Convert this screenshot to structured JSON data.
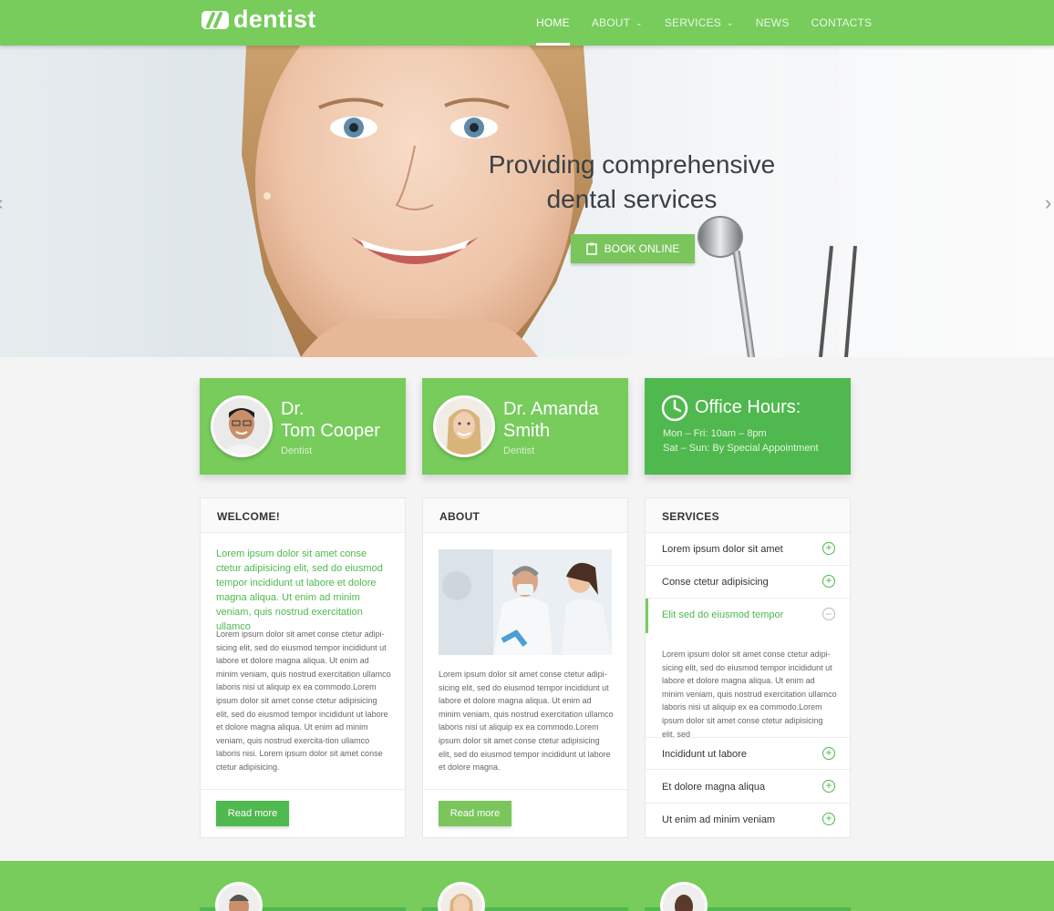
{
  "brand": {
    "name": "dentist",
    "accent": "#77cc5c",
    "accent_dark": "#4fb84e"
  },
  "nav": {
    "items": [
      {
        "label": "HOME",
        "active": true
      },
      {
        "label": "ABOUT",
        "has_dropdown": true
      },
      {
        "label": "SERVICES",
        "has_dropdown": true
      },
      {
        "label": "NEWS"
      },
      {
        "label": "CONTACTS"
      }
    ]
  },
  "hero": {
    "title_line1": "Providing comprehensive",
    "title_line2": "dental services",
    "button_label": "BOOK ONLINE",
    "button_icon": "clipboard-icon",
    "prev_icon": "chevron-left-icon",
    "next_icon": "chevron-right-icon"
  },
  "doctors": [
    {
      "name_line1": "Dr.",
      "name_line2": "Tom Cooper",
      "role": "Dentist"
    },
    {
      "name_line1": "Dr. Amanda",
      "name_line2": "Smith",
      "role": "Dentist"
    }
  ],
  "office_hours": {
    "title": "Office Hours:",
    "icon": "clock-icon",
    "line1": "Mon – Fri: 10am – 8pm",
    "line2": "Sat – Sun: By Special Appointment"
  },
  "welcome": {
    "heading": "WELCOME!",
    "lead": "Lorem ipsum dolor sit amet conse ctetur adipisicing elit, sed do eiusmod tempor incididunt ut labore et dolore magna aliqua. Ut enim ad minim veniam, quis nostrud exercitation ullamco",
    "body": "Lorem ipsum dolor sit amet conse ctetur adipi-sicing elit, sed do eiusmod tempor incididunt ut labore et dolore magna aliqua. Ut enim ad minim veniam, quis nostrud exercitation ullamco laboris nisi ut aliquip ex ea commodo.Lorem ipsum dolor sit amet conse ctetur adipisicing elit, sed do eiusmod tempor incididunt ut labore et dolore magna aliqua. Ut enim ad minim veniam, quis nostrud exercita-tion ullamco laboris nisi. Lorem ipsum dolor sit amet conse ctetur adipisicing.",
    "button_label": "Read more"
  },
  "about": {
    "heading": "ABOUT",
    "body": "Lorem ipsum dolor sit amet conse ctetur adipi-sicing elit, sed do eiusmod tempor incididunt ut labore et dolore magna aliqua. Ut enim ad minim veniam, quis nostrud exercitation ullamco laboris nisi ut aliquip ex ea commodo.Lorem ipsum dolor sit amet conse ctetur adipisicing elit, sed do eiusmod tempor incididunt ut labore et dolore magna.",
    "button_label": "Read more"
  },
  "services": {
    "heading": "SERVICES",
    "items": [
      {
        "label": "Lorem ipsum dolor sit amet",
        "open": false
      },
      {
        "label": "Conse ctetur adipisicing",
        "open": false
      },
      {
        "label": "Elit sed do eiusmod tempor",
        "open": true
      },
      {
        "label": "Incididunt ut labore",
        "open": false
      },
      {
        "label": "Et dolore magna aliqua",
        "open": false
      },
      {
        "label": "Ut enim ad minim veniam",
        "open": false
      }
    ],
    "open_body": "Lorem ipsum dolor sit amet conse ctetur adipi-sicing elit, sed do eiusmod tempor incididunt ut labore et dolore magna aliqua. Ut enim ad minim veniam, quis nostrud exercitation ullamco laboris nisi ut aliquip ex ea commodo.Lorem ipsum dolor sit amet conse ctetur adipisicing elit, sed",
    "plus_icon": "plus-circle-icon",
    "minus_icon": "minus-circle-icon"
  }
}
